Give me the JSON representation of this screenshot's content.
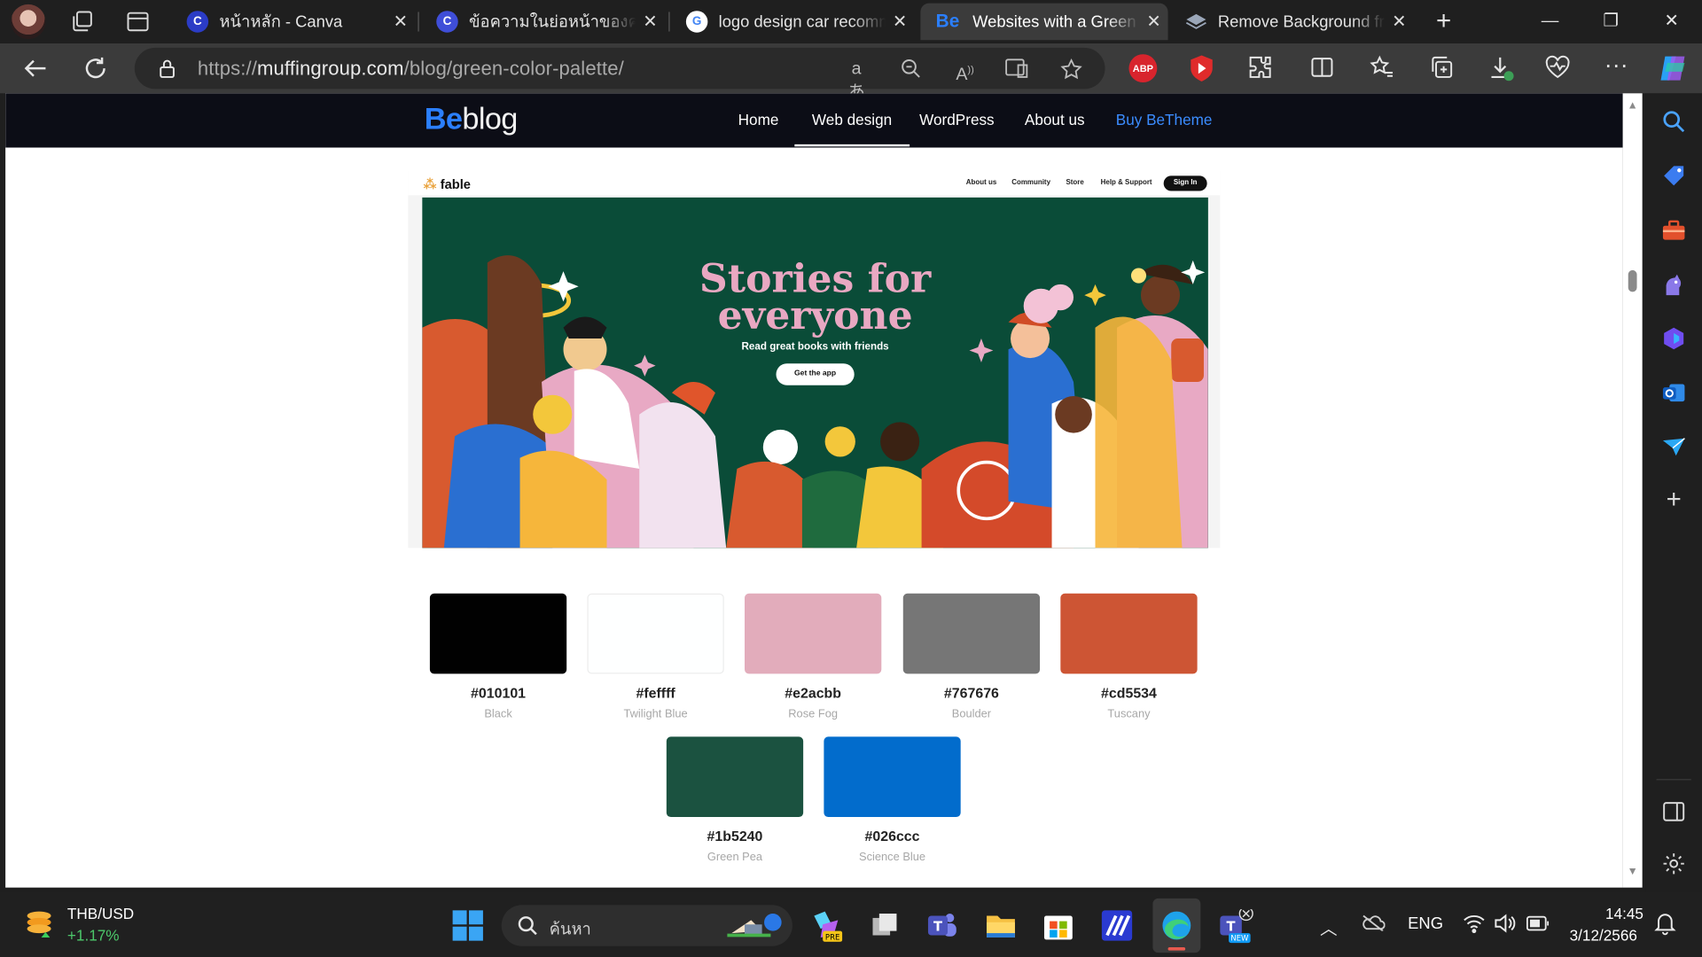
{
  "browser": {
    "tabs": [
      {
        "title": "หน้าหลัก - Canva",
        "favicon": "canva-icon",
        "active": false
      },
      {
        "title": "ข้อความในย่อหน้าของคุณ - Canva",
        "favicon": "canva-icon",
        "active": false
      },
      {
        "title": "logo design car recommendation",
        "favicon": "google-icon",
        "active": false
      },
      {
        "title": "Websites with a Green Color Palette",
        "favicon": "be-icon",
        "active": true
      },
      {
        "title": "Remove Background from Image",
        "favicon": "layers-icon",
        "active": false
      }
    ],
    "url_prefix": "https://",
    "url_host": "muffingroup.com",
    "url_path": "/blog/green-color-palette/",
    "read_aloud": "aあ",
    "adblock_label": "ABP"
  },
  "site": {
    "logo_be": "Be",
    "logo_blog": "blog",
    "nav": [
      {
        "label": "Home"
      },
      {
        "label": "Web design",
        "active": true
      },
      {
        "label": "WordPress"
      },
      {
        "label": "About us"
      },
      {
        "label": "Buy BeTheme",
        "accent": true
      }
    ]
  },
  "screenshot": {
    "logo": "fable",
    "nav": [
      "About us",
      "Community",
      "Store",
      "Help & Support"
    ],
    "signin": "Sign In",
    "hero_title_line1": "Stories for",
    "hero_title_line2": "everyone",
    "hero_subtitle": "Read great books with friends",
    "cta": "Get the app"
  },
  "palette": [
    {
      "hex": "#010101",
      "name": "Black",
      "color": "#010101"
    },
    {
      "hex": "#feffff",
      "name": "Twilight Blue",
      "color": "#feffff"
    },
    {
      "hex": "#e2acbb",
      "name": "Rose Fog",
      "color": "#e2acbb"
    },
    {
      "hex": "#767676",
      "name": "Boulder",
      "color": "#767676"
    },
    {
      "hex": "#cd5534",
      "name": "Tuscany",
      "color": "#cd5534"
    },
    {
      "hex": "#1b5240",
      "name": "Green Pea",
      "color": "#1b5240"
    },
    {
      "hex": "#026ccc",
      "name": "Science Blue",
      "color": "#026ccc"
    }
  ],
  "taskbar": {
    "currency_pair": "THB/USD",
    "currency_change": "+1.17%",
    "search_placeholder": "ค้นหา",
    "language": "ENG",
    "time": "14:45",
    "date": "3/12/2566"
  }
}
